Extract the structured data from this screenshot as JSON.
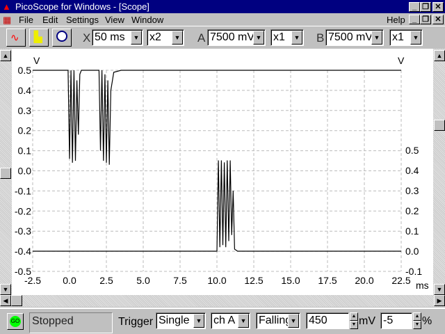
{
  "window": {
    "title": "PicoScope for Windows - [Scope]"
  },
  "menu": {
    "items": [
      "File",
      "Edit",
      "Settings",
      "View",
      "Window"
    ],
    "help": "Help"
  },
  "toolbar": {
    "x_label": "X",
    "timebase": "50 ms",
    "x_mult": "x2",
    "a_label": "A",
    "a_range": "7500 mV",
    "a_mult": "x1",
    "b_label": "B",
    "b_range": "7500 mV",
    "b_mult": "x1"
  },
  "status": {
    "go": "GO",
    "state": "Stopped",
    "trigger_label": "Trigger",
    "mode": "Single",
    "channel": "ch A",
    "edge": "Falling",
    "level": "450",
    "level_unit": "mV",
    "delay": "-5",
    "delay_unit": "%"
  },
  "colors": {
    "title_bg": "#000080",
    "trace": "#000000",
    "go": "#00ff00"
  },
  "chart_data": {
    "type": "line",
    "xlabel": "ms",
    "left_unit": "V",
    "right_unit": "V",
    "xlim": [
      -2.5,
      22.5
    ],
    "left_ylim": [
      -0.5,
      0.5
    ],
    "right_ylim": [
      -0.1,
      0.5
    ],
    "x_ticks": [
      "-2.5",
      "0.0",
      "2.5",
      "5.0",
      "7.5",
      "10.0",
      "12.5",
      "15.0",
      "17.5",
      "20.0",
      "22.5"
    ],
    "left_ticks": [
      "0.5",
      "0.4",
      "0.3",
      "0.2",
      "0.1",
      "0.0",
      "-0.1",
      "-0.2",
      "-0.3",
      "-0.4",
      "-0.5"
    ],
    "right_ticks": [
      "0.5",
      "0.4",
      "0.3",
      "0.2",
      "0.1",
      "0.0",
      "-0.1"
    ],
    "grid": true,
    "series": [
      {
        "name": "A",
        "axis": "left",
        "points": [
          [
            -2.5,
            0.5
          ],
          [
            -0.1,
            0.5
          ],
          [
            0,
            0.06
          ],
          [
            0.1,
            0.5
          ],
          [
            0.2,
            0.04
          ],
          [
            0.3,
            0.5
          ],
          [
            0.4,
            0.05
          ],
          [
            0.5,
            0.45
          ],
          [
            0.6,
            0.18
          ],
          [
            0.7,
            0.48
          ],
          [
            0.8,
            0.5
          ],
          [
            2.0,
            0.5
          ],
          [
            2.1,
            0.1
          ],
          [
            2.2,
            0.5
          ],
          [
            2.3,
            0.05
          ],
          [
            2.4,
            0.48
          ],
          [
            2.5,
            0.04
          ],
          [
            2.6,
            0.45
          ],
          [
            2.7,
            0.03
          ],
          [
            2.8,
            0.4
          ],
          [
            3.0,
            0.49
          ],
          [
            3.5,
            0.5
          ],
          [
            22.5,
            0.5
          ]
        ]
      },
      {
        "name": "B",
        "axis": "right",
        "points": [
          [
            -2.5,
            0.0
          ],
          [
            10.0,
            0.0
          ],
          [
            10.1,
            0.45
          ],
          [
            10.2,
            0.02
          ],
          [
            10.3,
            0.45
          ],
          [
            10.4,
            0.03
          ],
          [
            10.5,
            0.44
          ],
          [
            10.6,
            0.02
          ],
          [
            10.7,
            0.45
          ],
          [
            10.8,
            0.05
          ],
          [
            10.9,
            0.45
          ],
          [
            11.0,
            0.08
          ],
          [
            11.1,
            0.3
          ],
          [
            11.2,
            0.01
          ],
          [
            11.4,
            0.0
          ],
          [
            22.5,
            0.0
          ]
        ]
      }
    ]
  }
}
